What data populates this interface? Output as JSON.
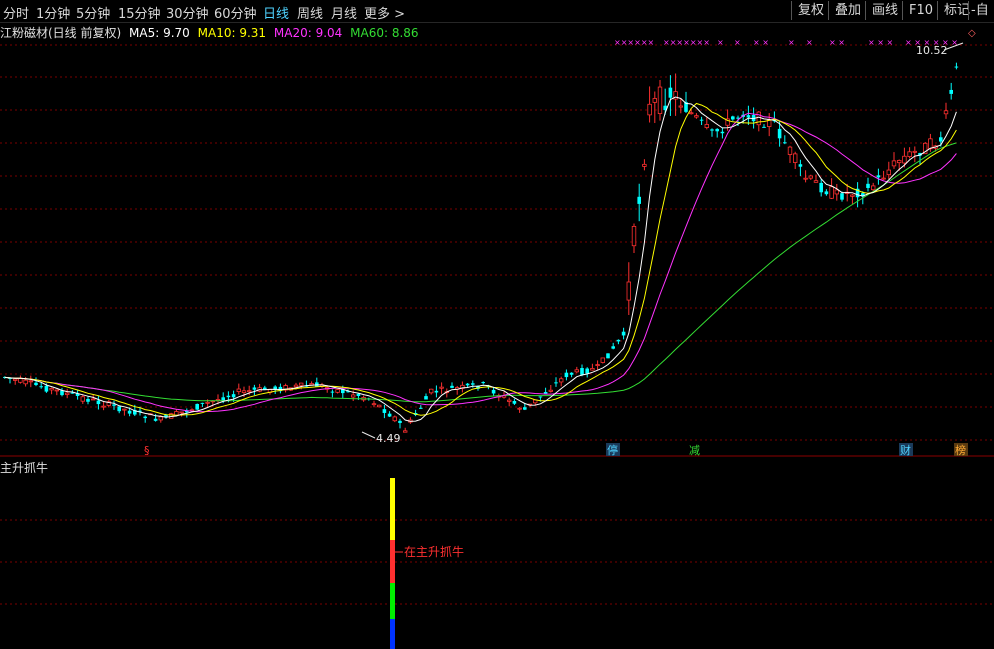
{
  "toolbar": {
    "timeframes": [
      "分时",
      "1分钟",
      "5分钟",
      "15分钟",
      "30分钟",
      "60分钟",
      "日线",
      "周线",
      "月线"
    ],
    "active_timeframe": "日线",
    "more_label": "更多 >",
    "right_buttons": [
      "复权",
      "叠加",
      "画线",
      "F10",
      "标记",
      "-自"
    ]
  },
  "info_bar": {
    "stock_title": "江粉磁材(日线 前复权)",
    "ma": [
      {
        "label": "MA5: 9.70",
        "color": "#ffffff"
      },
      {
        "label": "MA10: 9.31",
        "color": "#ffff00"
      },
      {
        "label": "MA20: 9.04",
        "color": "#ff33ff"
      },
      {
        "label": "MA60: 8.86",
        "color": "#33dd33"
      }
    ]
  },
  "main_chart": {
    "high_label": "10.52",
    "low_label": "4.49",
    "markers": [
      {
        "text": "§",
        "color": "#ff3030"
      },
      {
        "text": "停",
        "color": "#4fd3ff"
      },
      {
        "text": "减",
        "color": "#33dd33"
      },
      {
        "text": "财",
        "color": "#4fd3ff"
      },
      {
        "text": "榜",
        "color": "#ffaa33"
      }
    ],
    "colors": {
      "up": "#ff3030",
      "down": "#00ffff",
      "ma5": "#ffffff",
      "ma10": "#ffff00",
      "ma20": "#ff33ff",
      "ma60": "#33dd33",
      "grid": "#7a0000"
    }
  },
  "sub_chart": {
    "title": "主升抓牛",
    "signal_label": "在主升抓牛",
    "bar_colors": [
      "#ffff00",
      "#ff3030",
      "#00ee00",
      "#0033ff"
    ]
  }
}
